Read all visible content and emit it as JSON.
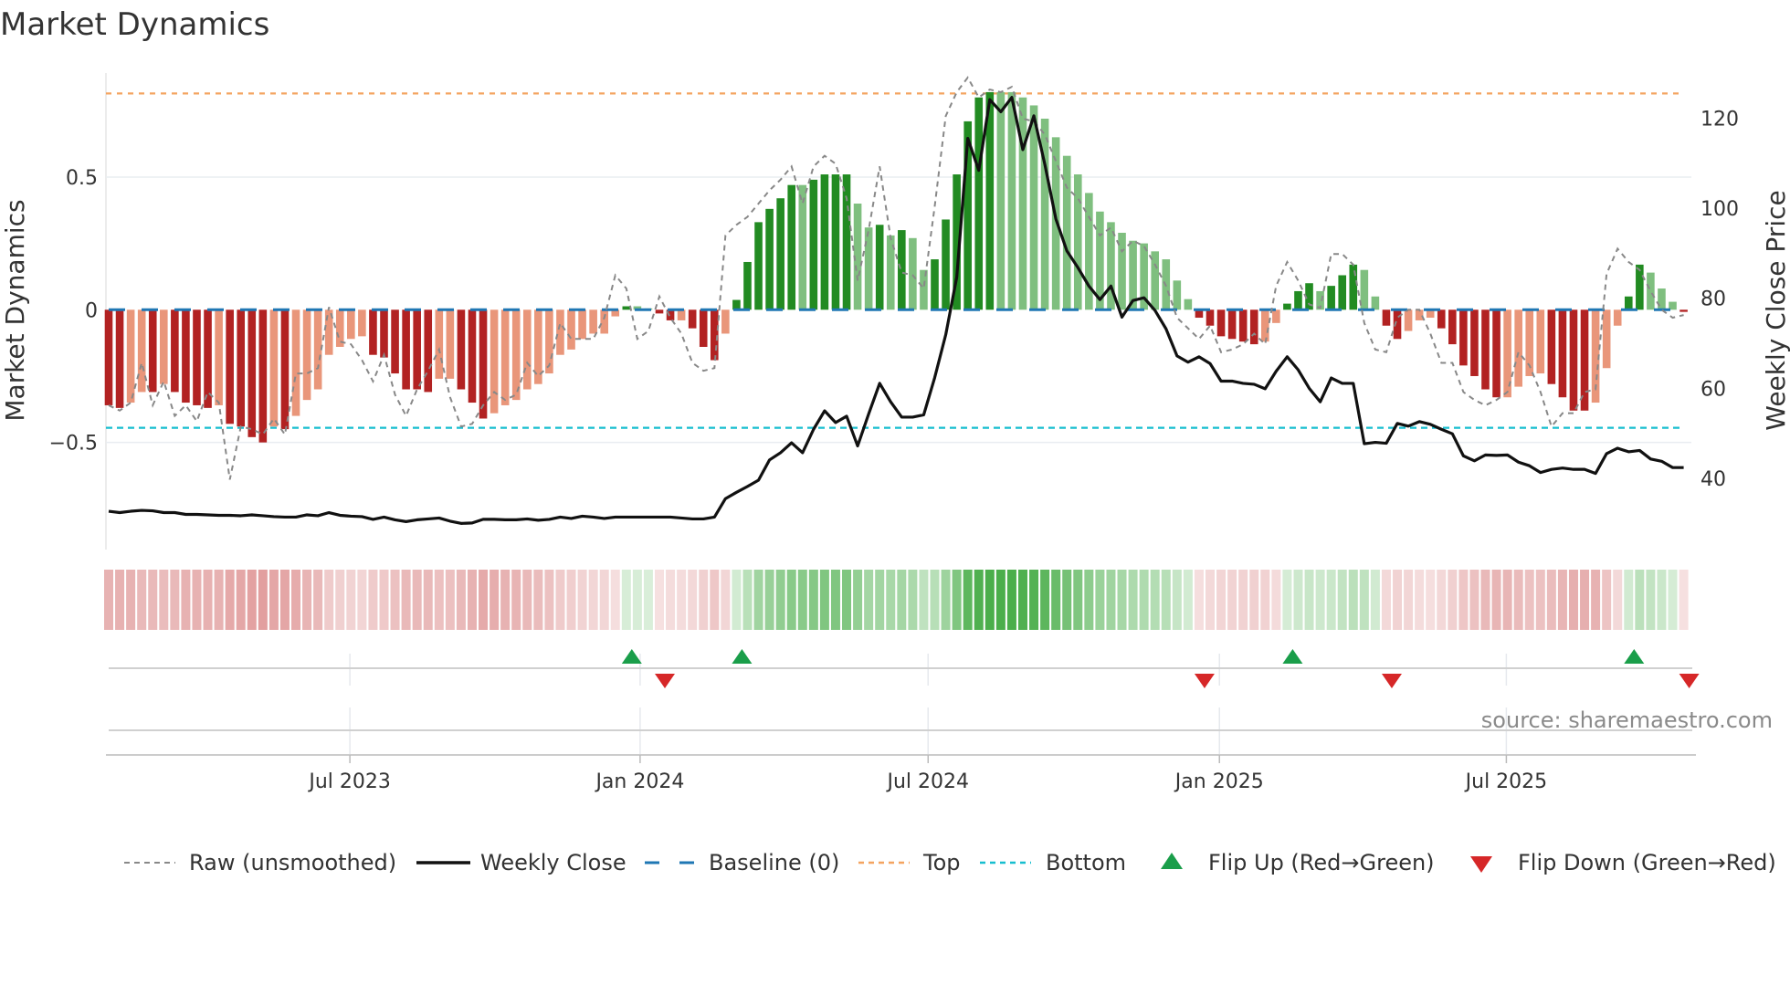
{
  "chart_data": {
    "type": "bar",
    "title": "Market Dynamics",
    "ylabel_left": "Market Dynamics",
    "ylabel_right": "Weekly Close Price",
    "ylim_left": [
      -0.94,
      0.9
    ],
    "ylim_right": [
      24,
      130
    ],
    "left_ticks": [
      {
        "v": 0.5,
        "label": "0.5"
      },
      {
        "v": 0,
        "label": "0"
      },
      {
        "v": -0.5,
        "label": "−0.5"
      }
    ],
    "right_ticks": [
      {
        "v": 40,
        "label": "40"
      },
      {
        "v": 60,
        "label": "60"
      },
      {
        "v": 80,
        "label": "80"
      },
      {
        "v": 100,
        "label": "100"
      },
      {
        "v": 120,
        "label": "120"
      }
    ],
    "x_unit": "week index",
    "x_ticks": [
      {
        "x": 21.9,
        "label": "Jul 2023"
      },
      {
        "x": 48.25,
        "label": "Jan 2024"
      },
      {
        "x": 74.4,
        "label": "Jul 2024"
      },
      {
        "x": 100.85,
        "label": "Jan 2025"
      },
      {
        "x": 126.9,
        "label": "Jul 2025"
      }
    ],
    "top_level": 0.815,
    "bottom_level": -0.445,
    "baseline": 0,
    "values": [
      -0.36,
      -0.37,
      -0.35,
      -0.31,
      -0.31,
      -0.28,
      -0.31,
      -0.35,
      -0.36,
      -0.37,
      -0.36,
      -0.43,
      -0.44,
      -0.48,
      -0.5,
      -0.44,
      -0.45,
      -0.4,
      -0.34,
      -0.3,
      -0.17,
      -0.14,
      -0.11,
      -0.1,
      -0.17,
      -0.18,
      -0.24,
      -0.3,
      -0.3,
      -0.31,
      -0.26,
      -0.26,
      -0.3,
      -0.35,
      -0.41,
      -0.39,
      -0.36,
      -0.34,
      -0.3,
      -0.28,
      -0.24,
      -0.17,
      -0.15,
      -0.11,
      -0.09,
      -0.09,
      -0.025,
      0.013,
      0.013,
      0.005,
      -0.014,
      -0.04,
      -0.04,
      -0.07,
      -0.14,
      -0.19,
      -0.09,
      0.037,
      0.18,
      0.33,
      0.38,
      0.42,
      0.47,
      0.47,
      0.49,
      0.51,
      0.51,
      0.51,
      0.4,
      0.31,
      0.32,
      0.28,
      0.3,
      0.27,
      0.15,
      0.19,
      0.34,
      0.51,
      0.71,
      0.8,
      0.82,
      0.82,
      0.82,
      0.8,
      0.77,
      0.72,
      0.65,
      0.58,
      0.51,
      0.44,
      0.37,
      0.33,
      0.29,
      0.26,
      0.25,
      0.22,
      0.19,
      0.11,
      0.04,
      -0.03,
      -0.06,
      -0.1,
      -0.11,
      -0.12,
      -0.13,
      -0.12,
      -0.05,
      0.023,
      0.07,
      0.1,
      0.07,
      0.09,
      0.13,
      0.17,
      0.15,
      0.05,
      -0.06,
      -0.11,
      -0.08,
      -0.04,
      -0.03,
      -0.07,
      -0.13,
      -0.21,
      -0.25,
      -0.3,
      -0.33,
      -0.33,
      -0.29,
      -0.25,
      -0.24,
      -0.28,
      -0.33,
      -0.38,
      -0.38,
      -0.35,
      -0.22,
      -0.06,
      0.05,
      0.17,
      0.14,
      0.08,
      0.03,
      -0.008
    ],
    "shades": "DDLLDLDDDDLDDDDLDLLLLLLLDDDDDDLLDDDLLLLLLLLLLLLDLLDDLDDDLDDDDDDLDDDDLLDLDLLDDDDDDLLLLLLLLLLLLLLLLLLDDDDDDLLDDDLDDDLLDDLLLDDDDDDLLLLDDDDLLLDDLLLD",
    "raw": [
      -0.36,
      -0.38,
      -0.35,
      -0.2,
      -0.36,
      -0.27,
      -0.4,
      -0.36,
      -0.42,
      -0.31,
      -0.35,
      -0.64,
      -0.44,
      -0.45,
      -0.47,
      -0.41,
      -0.47,
      -0.24,
      -0.24,
      -0.22,
      0.01,
      -0.12,
      -0.13,
      -0.19,
      -0.27,
      -0.17,
      -0.32,
      -0.4,
      -0.3,
      -0.23,
      -0.15,
      -0.33,
      -0.44,
      -0.43,
      -0.36,
      -0.31,
      -0.34,
      -0.32,
      -0.2,
      -0.25,
      -0.21,
      -0.05,
      -0.11,
      -0.11,
      -0.11,
      -0.03,
      0.13,
      0.08,
      -0.11,
      -0.08,
      0.05,
      -0.03,
      -0.09,
      -0.2,
      -0.23,
      -0.22,
      0.28,
      0.32,
      0.35,
      0.4,
      0.45,
      0.49,
      0.54,
      0.4,
      0.54,
      0.58,
      0.55,
      0.42,
      0.11,
      0.3,
      0.54,
      0.27,
      0.14,
      0.13,
      0.08,
      0.39,
      0.73,
      0.82,
      0.875,
      0.8,
      0.83,
      0.82,
      0.84,
      0.72,
      0.71,
      0.66,
      0.56,
      0.46,
      0.42,
      0.35,
      0.28,
      0.31,
      0.22,
      0.26,
      0.24,
      0.17,
      0.09,
      -0.03,
      -0.07,
      -0.11,
      -0.06,
      -0.16,
      -0.15,
      -0.13,
      -0.09,
      -0.13,
      0.09,
      0.18,
      0.11,
      0.02,
      0.007,
      0.21,
      0.21,
      0.17,
      -0.05,
      -0.15,
      -0.16,
      -0.03,
      0.0,
      0.0,
      -0.09,
      -0.2,
      -0.2,
      -0.31,
      -0.34,
      -0.36,
      -0.34,
      -0.31,
      -0.16,
      -0.21,
      -0.31,
      -0.44,
      -0.39,
      -0.39,
      -0.31,
      -0.3,
      0.135,
      0.23,
      0.18,
      0.15,
      0.07,
      0.0,
      -0.03,
      -0.02
    ],
    "price": [
      32.7,
      32.4,
      32.7,
      32.9,
      32.8,
      32.4,
      32.4,
      32.0,
      32.0,
      31.9,
      31.8,
      31.8,
      31.7,
      31.9,
      31.7,
      31.5,
      31.4,
      31.4,
      31.9,
      31.7,
      32.4,
      31.8,
      31.6,
      31.5,
      30.9,
      31.4,
      30.8,
      30.4,
      30.8,
      31.0,
      31.2,
      30.5,
      30.0,
      30.1,
      30.9,
      30.9,
      30.8,
      30.8,
      31.0,
      30.7,
      30.9,
      31.4,
      31.1,
      31.6,
      31.4,
      31.1,
      31.4,
      31.4,
      31.4,
      31.4,
      31.4,
      31.4,
      31.2,
      31.0,
      31.0,
      31.4,
      35.5,
      36.9,
      38.2,
      39.6,
      44.1,
      45.7,
      47.9,
      45.7,
      50.9,
      55.0,
      52.4,
      53.8,
      47.2,
      54.3,
      61.1,
      57.0,
      53.6,
      53.6,
      54.1,
      62.4,
      71.9,
      84.7,
      115.5,
      108.4,
      124.1,
      121.4,
      124.6,
      113.0,
      120.5,
      109.7,
      97.6,
      90.5,
      86.8,
      82.7,
      79.7,
      82.7,
      75.8,
      79.5,
      80.1,
      77.3,
      73.2,
      67.2,
      65.8,
      67.0,
      65.5,
      61.6,
      61.6,
      61.1,
      60.9,
      59.9,
      63.8,
      67.0,
      64.1,
      60.0,
      57.0,
      62.3,
      61.1,
      61.1,
      47.7,
      48.0,
      47.8,
      52.2,
      51.6,
      52.6,
      52.0,
      50.9,
      49.9,
      45.0,
      43.9,
      45.2,
      45.1,
      45.2,
      43.6,
      42.8,
      41.3,
      42.0,
      42.3,
      42.0,
      42.0,
      41.1,
      45.5,
      46.7,
      45.9,
      46.2,
      44.3,
      43.8,
      42.4,
      42.4
    ],
    "flip_up": [
      47,
      57,
      107,
      138
    ],
    "flip_down": [
      50,
      99,
      116,
      143
    ],
    "legend": {
      "position": "bottom",
      "items": [
        {
          "label": "Raw (unsmoothed)",
          "kind": "raw"
        },
        {
          "label": "Weekly Close",
          "kind": "close"
        },
        {
          "label": "Baseline (0)",
          "kind": "baseline"
        },
        {
          "label": "Top",
          "kind": "top"
        },
        {
          "label": "Bottom",
          "kind": "bottom"
        },
        {
          "label": "Flip Up (Red→Green)",
          "kind": "up"
        },
        {
          "label": "Flip Down (Green→Red)",
          "kind": "down"
        }
      ]
    },
    "colors": {
      "pos_dark": "#228b22",
      "pos_light": "#7fbf7f",
      "neg_dark": "#b22222",
      "neg_light": "#e9967a",
      "close": "#111111",
      "raw": "#888888",
      "baseline": "#1f77b4",
      "top": "#f4a460",
      "bottom": "#17becf",
      "flip_up": "#1a9e4a",
      "flip_down": "#d62728",
      "strip_pos": "#2ca02c",
      "strip_neg": "#cd5c5c"
    }
  },
  "source": "source: sharemaestro.com"
}
